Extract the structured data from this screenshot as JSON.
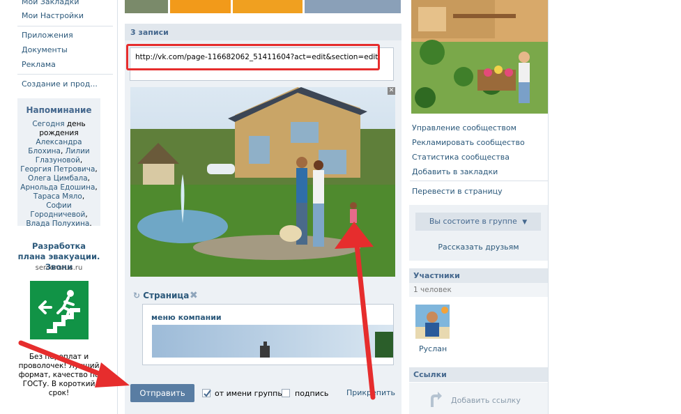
{
  "left_nav": {
    "items": [
      "Мои Закладки",
      "Мои Настройки",
      "Приложения",
      "Документы",
      "Реклама",
      "Создание и прод..."
    ]
  },
  "reminder": {
    "title": "Напоминание",
    "today": "Сегодня",
    "text_lead": " день рождения ",
    "names": [
      "Александра Блохина",
      "Лилии Глазуновой",
      "Георгия Петровича",
      "Олега Цимбала",
      "Арнольда Едошина",
      "Тараса Мяло",
      "Софии Городничевой",
      "Влада Полухина"
    ]
  },
  "ad": {
    "title": "Разработка плана эвакуации. Звони",
    "domain": "serconsrus.ru",
    "text": "Без переплат и проволочек! Лучший формат, качество по ГОСТу. В короткий срок!"
  },
  "post": {
    "header": "3 записи",
    "url": "http://vk.com/page-116682062_51411604?act=edit&section=edit",
    "page_label": "Страница",
    "page_card_title": "меню компании",
    "send_button": "Отправить",
    "from_group_label": "от имени группы",
    "from_group_checked": true,
    "signature_label": "подпись",
    "signature_checked": false,
    "attach_label": "Прикрепить"
  },
  "right": {
    "links": [
      "Управление сообществом",
      "Рекламировать сообщество",
      "Статистика сообщества",
      "Добавить в закладки"
    ],
    "translate": "Перевести в страницу",
    "member_button": "Вы состоите в группе",
    "tell_friends": "Рассказать друзьям",
    "members_title": "Участники",
    "members_count": "1 человек",
    "member_name": "Руслан",
    "links_title": "Ссылки",
    "add_link": "Добавить ссылку"
  },
  "colors": {
    "link": "#2b587a",
    "header_bg": "#e1e7ed",
    "panel_bg": "#edf1f5",
    "button": "#597da3",
    "highlight_red": "#e62d2d"
  }
}
